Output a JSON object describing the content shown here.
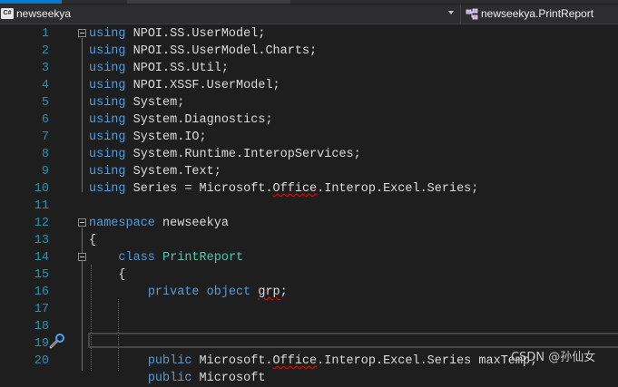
{
  "navbar": {
    "project_icon_text": "C#",
    "project": "newseekya",
    "class_member": "newseekya.PrintReport"
  },
  "lines": [
    {
      "n": "1",
      "parts": [
        {
          "t": "using",
          "c": "kw"
        },
        {
          "t": " NPOI.SS.UserModel;",
          "c": "plain"
        }
      ]
    },
    {
      "n": "2",
      "parts": [
        {
          "t": "using",
          "c": "kw"
        },
        {
          "t": " NPOI.SS.UserModel.Charts;",
          "c": "plain"
        }
      ]
    },
    {
      "n": "3",
      "parts": [
        {
          "t": "using",
          "c": "kw"
        },
        {
          "t": " NPOI.SS.Util;",
          "c": "plain"
        }
      ]
    },
    {
      "n": "4",
      "parts": [
        {
          "t": "using",
          "c": "kw"
        },
        {
          "t": " NPOI.XSSF.UserModel;",
          "c": "plain"
        }
      ]
    },
    {
      "n": "5",
      "parts": [
        {
          "t": "using",
          "c": "kw"
        },
        {
          "t": " System;",
          "c": "plain"
        }
      ]
    },
    {
      "n": "6",
      "parts": [
        {
          "t": "using",
          "c": "kw"
        },
        {
          "t": " System.Diagnostics;",
          "c": "plain"
        }
      ]
    },
    {
      "n": "7",
      "parts": [
        {
          "t": "using",
          "c": "kw"
        },
        {
          "t": " System.IO;",
          "c": "plain"
        }
      ]
    },
    {
      "n": "8",
      "parts": [
        {
          "t": "using",
          "c": "kw"
        },
        {
          "t": " System.Runtime.InteropServices;",
          "c": "plain"
        }
      ]
    },
    {
      "n": "9",
      "parts": [
        {
          "t": "using",
          "c": "kw"
        },
        {
          "t": " System.Text;",
          "c": "plain"
        }
      ]
    },
    {
      "n": "10",
      "parts": [
        {
          "t": "using",
          "c": "kw"
        },
        {
          "t": " Series = Microsoft.",
          "c": "plain"
        },
        {
          "t": "Office",
          "c": "plain squiggle"
        },
        {
          "t": ".Interop.Excel.Series;",
          "c": "plain"
        }
      ]
    },
    {
      "n": "11",
      "parts": []
    },
    {
      "n": "12",
      "parts": [
        {
          "t": "namespace",
          "c": "kw"
        },
        {
          "t": " newseekya",
          "c": "plain"
        }
      ]
    },
    {
      "n": "13",
      "parts": [
        {
          "t": "{",
          "c": "plain"
        }
      ]
    },
    {
      "n": "14",
      "parts": [
        {
          "t": "    ",
          "c": "plain"
        },
        {
          "t": "class",
          "c": "kw"
        },
        {
          "t": " ",
          "c": "plain"
        },
        {
          "t": "PrintReport",
          "c": "ty"
        }
      ]
    },
    {
      "n": "15",
      "parts": [
        {
          "t": "    {",
          "c": "plain"
        }
      ]
    },
    {
      "n": "16",
      "parts": [
        {
          "t": "        ",
          "c": "plain"
        },
        {
          "t": "private",
          "c": "kw"
        },
        {
          "t": " ",
          "c": "plain"
        },
        {
          "t": "object",
          "c": "kw"
        },
        {
          "t": " ",
          "c": "plain"
        },
        {
          "t": "grp",
          "c": "plain squiggle"
        },
        {
          "t": ";",
          "c": "plain"
        }
      ]
    },
    {
      "n": "17",
      "parts": []
    },
    {
      "n": "18",
      "parts": []
    },
    {
      "n": "19",
      "parts": []
    },
    {
      "n": "20",
      "parts": [
        {
          "t": "        ",
          "c": "plain"
        },
        {
          "t": "public",
          "c": "kw"
        },
        {
          "t": " Microsoft.",
          "c": "plain"
        },
        {
          "t": "Office",
          "c": "plain squiggle"
        },
        {
          "t": ".Interop.Excel.Series maxTemp;",
          "c": "plain"
        }
      ]
    },
    {
      "n": "",
      "parts": [
        {
          "t": "        ",
          "c": "plain"
        },
        {
          "t": "public",
          "c": "kw"
        },
        {
          "t": " Microsoft",
          "c": "plain"
        }
      ]
    }
  ],
  "watermark": "CSDN @孙仙女"
}
